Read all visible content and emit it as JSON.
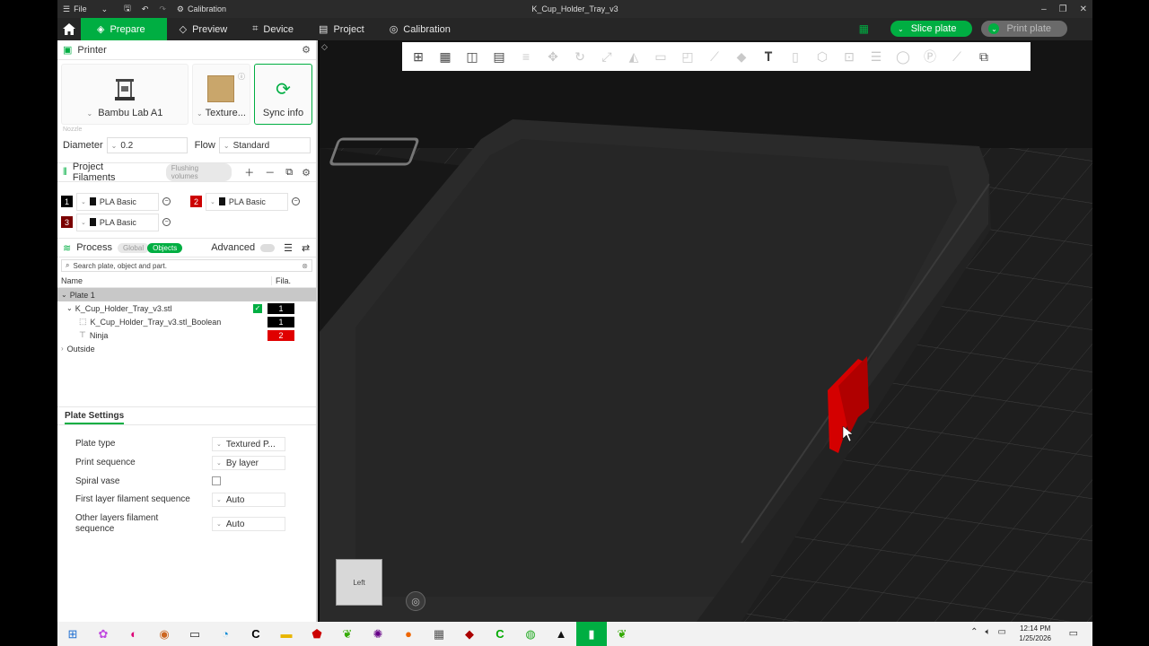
{
  "titlebar": {
    "file_label": "File",
    "calibration_label": "Calibration",
    "window_title": "K_Cup_Holder_Tray_v3"
  },
  "tabs": {
    "prepare": "Prepare",
    "preview": "Preview",
    "device": "Device",
    "project": "Project",
    "calibration": "Calibration"
  },
  "actions": {
    "slice_plate": "Slice plate",
    "print_plate": "Print plate"
  },
  "printer": {
    "section_title": "Printer",
    "printer_name": "Bambu Lab A1",
    "plate_label": "Texture...",
    "sync_label": "Sync info",
    "nozzle_label": "Nozzle",
    "diameter_label": "Diameter",
    "diameter_value": "0.2",
    "flow_label": "Flow",
    "flow_value": "Standard"
  },
  "filaments": {
    "section_title": "Project Filaments",
    "flushing_label": "Flushing volumes",
    "items": [
      {
        "num": "1",
        "name": "PLA Basic",
        "color": "#000000"
      },
      {
        "num": "2",
        "name": "PLA Basic",
        "color": "#cc0000"
      },
      {
        "num": "3",
        "name": "PLA Basic",
        "color": "#7a0000"
      }
    ]
  },
  "process": {
    "section_title": "Process",
    "global_label": "Global",
    "objects_label": "Objects",
    "advanced_label": "Advanced",
    "search_placeholder": "Search plate, object and part.",
    "col_name": "Name",
    "col_fila": "Fila.",
    "plate_label": "Plate 1",
    "object_name": "K_Cup_Holder_Tray_v3.stl",
    "object_fila": "1",
    "part_name": "K_Cup_Holder_Tray_v3.stl_Boolean",
    "part_fila": "1",
    "ninja_name": "Ninja",
    "ninja_fila": "2",
    "outside_label": "Outside"
  },
  "plate_settings": {
    "title": "Plate Settings",
    "plate_type_label": "Plate type",
    "plate_type_value": "Textured P...",
    "print_sequence_label": "Print sequence",
    "print_sequence_value": "By layer",
    "spiral_vase_label": "Spiral vase",
    "first_layer_label": "First layer filament sequence",
    "first_layer_value": "Auto",
    "other_layers_label_1": "Other layers filament",
    "other_layers_label_2": "sequence",
    "other_layers_value": "Auto"
  },
  "viewport": {
    "view_cube_label": "Left"
  },
  "taskbar": {
    "time": "12:14 PM",
    "date": "1/25/2026"
  },
  "colors": {
    "accent": "#00ae42",
    "filament_red": "#cc0000",
    "bed_grid": "#3b3b3b"
  }
}
